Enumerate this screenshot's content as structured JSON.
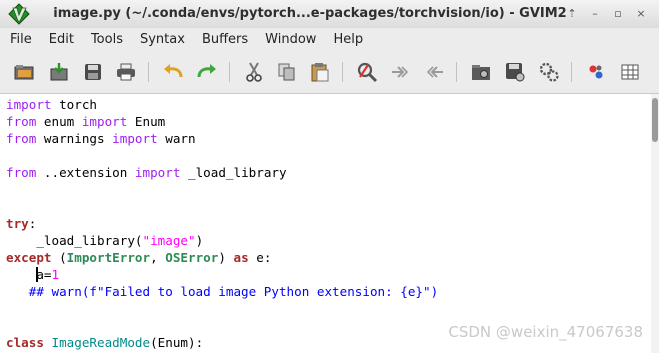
{
  "window": {
    "title": "image.py (~/.conda/envs/pytorch...e-packages/torchvision/io) - GVIM2",
    "controls": [
      "⇡",
      "–",
      "▫",
      "×"
    ]
  },
  "menu": [
    "File",
    "Edit",
    "Tools",
    "Syntax",
    "Buffers",
    "Window",
    "Help"
  ],
  "toolbar": [
    "open-icon",
    "save-icon",
    "save-all-icon",
    "print-icon",
    "undo-icon",
    "redo-icon",
    "cut-icon",
    "copy-icon",
    "paste-icon",
    "find-replace-icon",
    "find-next-icon",
    "find-prev-icon",
    "load-session-icon",
    "save-session-icon",
    "run-script-icon",
    "make-icon",
    "tag-jump-icon"
  ],
  "code": {
    "lines": [
      [
        {
          "t": "import",
          "c": "kw-preproc"
        },
        {
          "t": " torch",
          "c": ""
        }
      ],
      [
        {
          "t": "from",
          "c": "kw-preproc"
        },
        {
          "t": " enum ",
          "c": ""
        },
        {
          "t": "import",
          "c": "kw-preproc"
        },
        {
          "t": " Enum",
          "c": ""
        }
      ],
      [
        {
          "t": "from",
          "c": "kw-preproc"
        },
        {
          "t": " warnings ",
          "c": ""
        },
        {
          "t": "import",
          "c": "kw-preproc"
        },
        {
          "t": " warn",
          "c": ""
        }
      ],
      [],
      [
        {
          "t": "from",
          "c": "kw-preproc"
        },
        {
          "t": " ..extension ",
          "c": ""
        },
        {
          "t": "import",
          "c": "kw-preproc"
        },
        {
          "t": " _load_library",
          "c": ""
        }
      ],
      [],
      [],
      [
        {
          "t": "try",
          "c": "kw-stmt"
        },
        {
          "t": ":",
          "c": ""
        }
      ],
      [
        {
          "t": "    _load_library(",
          "c": ""
        },
        {
          "t": "\"image\"",
          "c": "kw-str"
        },
        {
          "t": ")",
          "c": ""
        }
      ],
      [
        {
          "t": "except",
          "c": "kw-stmt"
        },
        {
          "t": " (",
          "c": ""
        },
        {
          "t": "ImportError",
          "c": "kw-type"
        },
        {
          "t": ", ",
          "c": ""
        },
        {
          "t": "OSError",
          "c": "kw-type"
        },
        {
          "t": ") ",
          "c": ""
        },
        {
          "t": "as",
          "c": "kw-stmt"
        },
        {
          "t": " e:",
          "c": ""
        }
      ],
      [
        {
          "t": "    ",
          "c": ""
        },
        {
          "t": "",
          "c": "cursor"
        },
        {
          "t": "a=",
          "c": ""
        },
        {
          "t": "1",
          "c": "kw-str"
        }
      ],
      [
        {
          "t": "   ## warn(f\"Failed to load image Python extension: {e}\")",
          "c": "kw-comment"
        }
      ],
      [],
      [],
      [
        {
          "t": "class",
          "c": "kw-stmt"
        },
        {
          "t": " ",
          "c": ""
        },
        {
          "t": "ImageReadMode",
          "c": "kw-func"
        },
        {
          "t": "(Enum):",
          "c": ""
        }
      ]
    ]
  },
  "watermark": "CSDN @weixin_47067638"
}
